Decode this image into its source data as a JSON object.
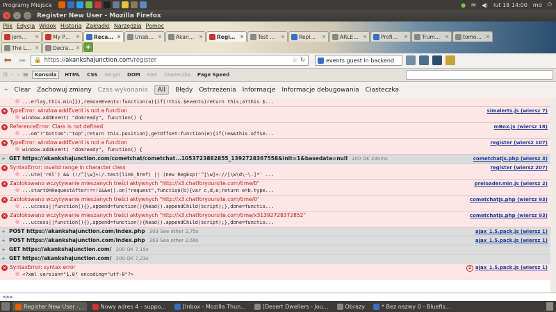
{
  "top_panel": {
    "menu_label": "Programy",
    "places_label": "Miejsca",
    "clock": "lut 18 14:00",
    "user": "md"
  },
  "window": {
    "title": "Register New User - Mozilla Firefox"
  },
  "menubar": [
    "Plik",
    "Edycja",
    "Widok",
    "Historia",
    "Zakładki",
    "Narzędzia",
    "Pomoc"
  ],
  "tabs_row1": [
    {
      "label": "Jom…",
      "color": "#c33"
    },
    {
      "label": "My P…",
      "color": "#c33"
    },
    {
      "label": "Reca…",
      "color": "#3a6ec4",
      "active": true
    },
    {
      "label": "Unab…",
      "color": "#888"
    },
    {
      "label": "Akan…",
      "color": "#888"
    },
    {
      "label": "Regi…",
      "color": "#c33",
      "active": true
    },
    {
      "label": "Test …",
      "color": "#888"
    },
    {
      "label": "Repl…",
      "color": "#3a6ec4"
    },
    {
      "label": "ARLE…",
      "color": "#888"
    },
    {
      "label": "Profi…",
      "color": "#3a6ec4"
    },
    {
      "label": "Trum…",
      "color": "#888"
    },
    {
      "label": "tomo…",
      "color": "#888"
    }
  ],
  "tabs_row2": [
    {
      "label": "The L…",
      "color": "#888"
    },
    {
      "label": "Decra…",
      "color": "#888"
    }
  ],
  "navbar": {
    "url_scheme": "https://",
    "url_host": "akankshajunction.com",
    "url_path": "/register",
    "search_text": "events guest in backend"
  },
  "devtools": {
    "tabs": [
      {
        "label": "Konsola",
        "state": "box"
      },
      {
        "label": "HTML",
        "state": "normal"
      },
      {
        "label": "CSS",
        "state": "normal"
      },
      {
        "label": "Skrypt",
        "state": "dim"
      },
      {
        "label": "DOM",
        "state": "normal"
      },
      {
        "label": "Sieć",
        "state": "dim"
      },
      {
        "label": "Ciasteczka",
        "state": "dim"
      },
      {
        "label": "Page Speed",
        "state": "normal"
      }
    ]
  },
  "filterbar": {
    "clear": "Clear",
    "persist": "Zachowuj zmiany",
    "timing": "Czas wykonania",
    "all": "All",
    "errors": "Błędy",
    "warnings": "Ostrzeżenia",
    "info": "Informacje",
    "debug": "Informacje debugowania",
    "cookies": "Ciasteczka"
  },
  "console": [
    {
      "type": "code-only",
      "code": "...erlay,this.min]}),removeEvents:function(a){if(!this.$events)return this;a?this.$..."
    },
    {
      "type": "err",
      "msg": "TypeError: window.addEvent is not a function",
      "code": "window.addEvent( \"domready\", function() {",
      "src": "simalerts.js (wiersz 7)"
    },
    {
      "type": "err",
      "msg": "ReferenceError: Class is not defined",
      "code": "...om\"?\"bottom\":\"top\";return this.position},getOffset:function(e){if(!e&&this.offse...",
      "src": "mBox.js (wiersz 18)"
    },
    {
      "type": "err",
      "msg": "TypeError: window.addEvent is not a function",
      "code": "window.addEvent( \"domready\", function() {",
      "src": "register (wiersz 107)"
    },
    {
      "type": "net",
      "method": "GET https://akankshajunction.com/cometchat/cometchat...1053723882855_1392728367558&init=1&basedata=null",
      "status": "200 OK 230ms",
      "src": "cometchatjs.php (wiersz 3)"
    },
    {
      "type": "err",
      "msg": "SyntaxError: invalid range in character class",
      "code": "...ute('rel') && (!/^[\\w]+:/.test(link_href) || (new RegExp('^[\\w]+://[\\w\\d\\-\\.]*' ...",
      "src": "register (wiersz 207)"
    },
    {
      "type": "err",
      "msg": "Zablokowano wczytywanie mieszanych treści aktywnych \"http://x3.chatforyoursite.com/time/0\"",
      "code": "...startOnRequestAfter!==!1&&e().on(\"request\",function(b){var c,d,e;return e=b.type...",
      "src": "preloader.min.js (wiersz 2)"
    },
    {
      "type": "err",
      "msg": "Zablokowano wczytywanie mieszanych treści aktywnych \"http://x3.chatforyoursite.com/time/0\"",
      "code": "...uccess||function(){},append=function(){head().appendChild(script);},done=functio...",
      "src": "cometchatjs.php (wiersz 93)"
    },
    {
      "type": "err",
      "msg": "Zablokowano wczytywanie mieszanych treści aktywnych \"http://x3.chatforyoursite.com/time/x31392728372852\"",
      "code": "...uccess||function(){},append=function(){head().appendChild(script);},done=functio...",
      "src": "cometchatjs.php (wiersz 93)"
    },
    {
      "type": "net",
      "method": "POST https://akankshajunction.com/index.php",
      "status": "303 See other 2,75s",
      "src": "ajax_1.5.pack.js (wiersz 1)"
    },
    {
      "type": "net",
      "method": "POST https://akankshajunction.com/index.php",
      "status": "303 See other 2,69s",
      "src": "ajax_1.5.pack.js (wiersz 1)"
    },
    {
      "type": "net",
      "method": "GET https://akankshajunction.com/",
      "status": "200 OK 7,15s",
      "src": ""
    },
    {
      "type": "net",
      "method": "GET https://akankshajunction.com/",
      "status": "200 OK 7,23s",
      "src": ""
    },
    {
      "type": "err",
      "msg": "SyntaxError: syntax error",
      "code": "<?xml version=\"1.0\" encoding=\"utf-8\"?>",
      "src": "ajax_1.5.pack.js (wiersz 1)",
      "count": "2"
    }
  ],
  "cmdline": ">>>",
  "taskbar": [
    {
      "label": "Register New User -...",
      "color": "#e66000",
      "active": true
    },
    {
      "label": "Nowy adres 4 - suppo...",
      "color": "#c33"
    },
    {
      "label": "[Inbox - Mozilla Thun...",
      "color": "#3a6ec4"
    },
    {
      "label": "[Desert Dwellers - Jou...",
      "color": "#888"
    },
    {
      "label": "Obrazy",
      "color": "#888"
    },
    {
      "label": "* Bez nazwy 0 - Bluefis...",
      "color": "#3a6ec4"
    }
  ]
}
